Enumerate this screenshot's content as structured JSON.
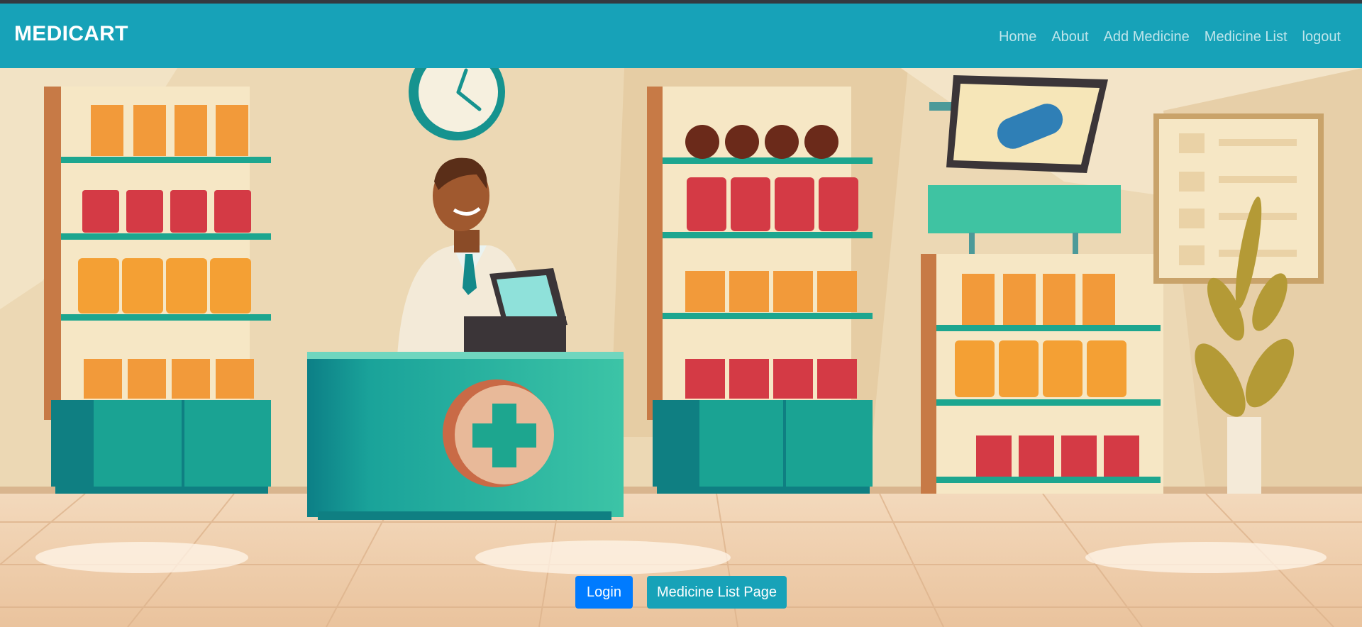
{
  "navbar": {
    "brand": "MEDICART",
    "links": [
      "Home",
      "About",
      "Add Medicine",
      "Medicine List",
      "logout"
    ]
  },
  "hero": {
    "illustration": "pharmacy-store-scene",
    "buttons": {
      "login_label": "Login",
      "medicine_list_label": "Medicine List Page"
    }
  },
  "colors": {
    "navbar": "#17a2b8",
    "login_button": "#007bff",
    "medicine_list_button": "#17a2b8",
    "teal": "#1fa595",
    "wall": "#ecd8b4"
  }
}
